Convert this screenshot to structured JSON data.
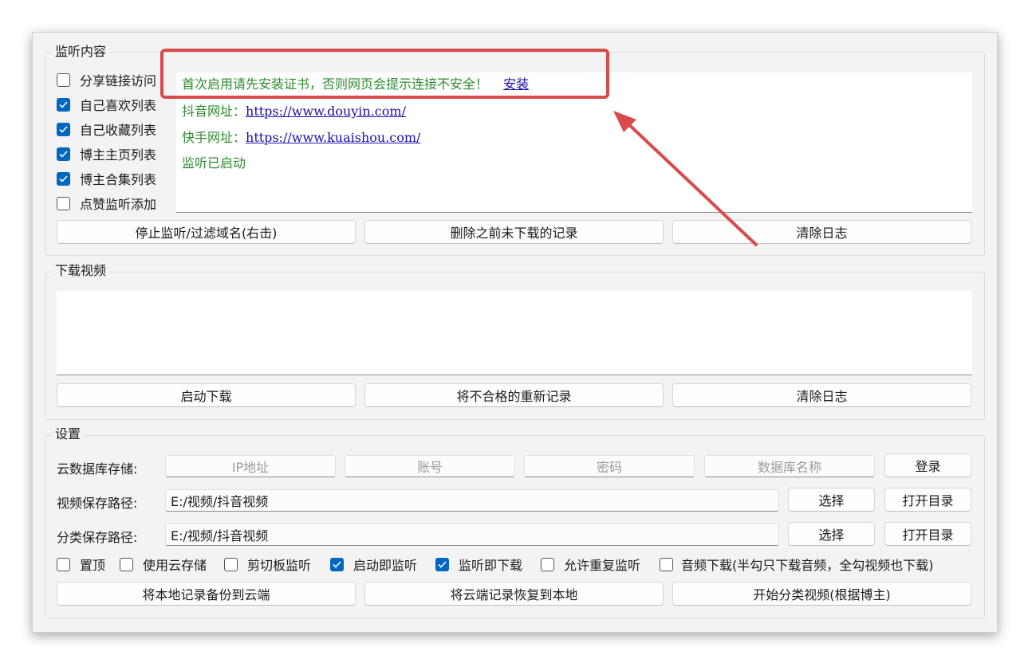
{
  "monitor_group": {
    "title": "监听内容",
    "checkboxes": [
      {
        "label": "分享链接访问",
        "checked": false
      },
      {
        "label": "自己喜欢列表",
        "checked": true
      },
      {
        "label": "自己收藏列表",
        "checked": true
      },
      {
        "label": "博主主页列表",
        "checked": true
      },
      {
        "label": "博主合集列表",
        "checked": true
      },
      {
        "label": "点赞监听添加",
        "checked": false
      }
    ],
    "log": {
      "cert_notice": "首次启用请先安装证书，否则网页会提示连接不安全！",
      "install_link": "安装",
      "douyin_label": "抖音网址：",
      "douyin_url": "https://www.douyin.com/",
      "kuaishou_label": "快手网址：",
      "kuaishou_url": "https://www.kuaishou.com/",
      "status": "监听已启动"
    },
    "buttons": [
      "停止监听/过滤域名(右击)",
      "删除之前未下载的记录",
      "清除日志"
    ]
  },
  "download_group": {
    "title": "下载视频",
    "buttons": [
      "启动下载",
      "将不合格的重新记录",
      "清除日志"
    ]
  },
  "settings_group": {
    "title": "设置",
    "cloud_db": {
      "label": "云数据库存储:",
      "ip_placeholder": "IP地址",
      "account_placeholder": "账号",
      "password_placeholder": "密码",
      "dbname_placeholder": "数据库名称",
      "login_button": "登录"
    },
    "video_path": {
      "label": "视频保存路径:",
      "value": "E:/视频/抖音视频",
      "select_button": "选择",
      "open_button": "打开目录"
    },
    "category_path": {
      "label": "分类保存路径:",
      "value": "E:/视频/抖音视频",
      "select_button": "选择",
      "open_button": "打开目录"
    },
    "options": [
      {
        "label": "置顶",
        "checked": false
      },
      {
        "label": "使用云存储",
        "checked": false
      },
      {
        "label": "剪切板监听",
        "checked": false
      },
      {
        "label": "启动即监听",
        "checked": true
      },
      {
        "label": "监听即下载",
        "checked": true
      },
      {
        "label": "允许重复监听",
        "checked": false
      },
      {
        "label": "音频下载(半勾只下载音频，全勾视频也下载)",
        "checked": false
      }
    ],
    "buttons": [
      "将本地记录备份到云端",
      "将云端记录恢复到本地",
      "开始分类视频(根据博主)"
    ]
  },
  "colors": {
    "accent": "#0067c0",
    "log_text": "#2e8b2e",
    "link": "#1a0dab",
    "annotation": "#d94a4a"
  }
}
